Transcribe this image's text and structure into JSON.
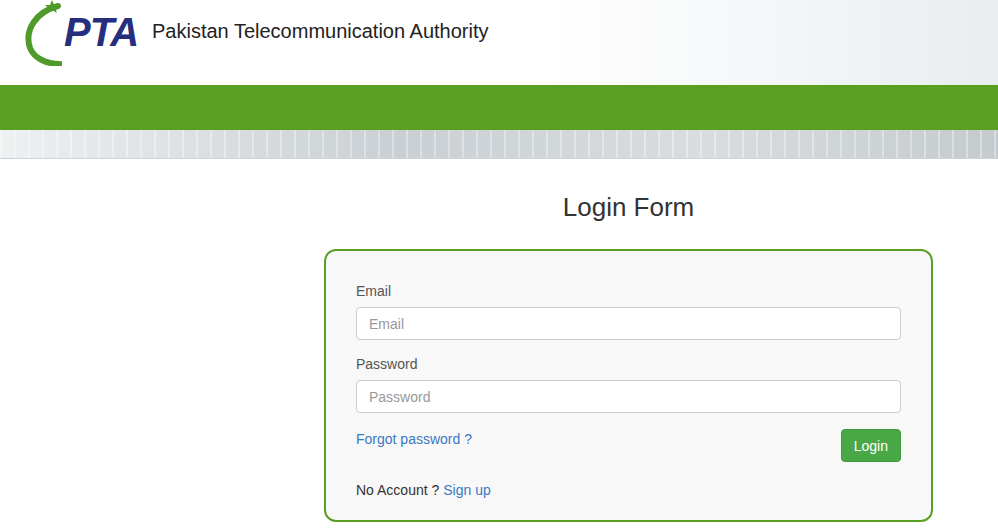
{
  "header": {
    "logo": "PTA",
    "title": "Pakistan Telecommunication Authority"
  },
  "form": {
    "title": "Login Form",
    "fields": [
      {
        "label": "Email",
        "placeholder": "Email",
        "type": "email"
      },
      {
        "label": "Password",
        "placeholder": "Password",
        "type": "password"
      }
    ],
    "forgot_link": "Forgot password ?",
    "submit_button": "Login",
    "signup_prompt": "No Account ?",
    "signup_link": "Sign up"
  }
}
